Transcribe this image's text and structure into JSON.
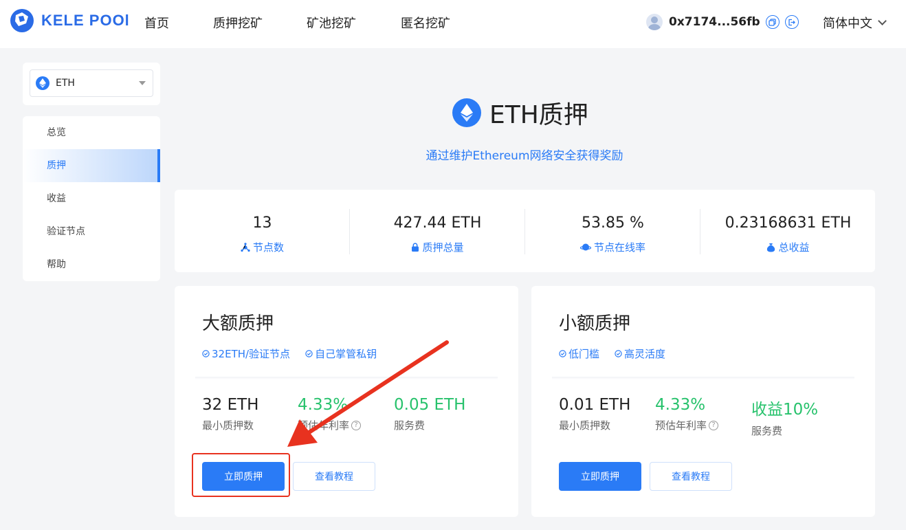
{
  "brand": {
    "logo_text": "KELE POOl"
  },
  "nav": {
    "items": [
      {
        "label": "首页"
      },
      {
        "label": "质押挖矿"
      },
      {
        "label": "矿池挖矿"
      },
      {
        "label": "匿名挖矿"
      }
    ]
  },
  "wallet": {
    "address": "0x7174...56fb"
  },
  "language": {
    "label": "简体中文"
  },
  "sidebar": {
    "coin_select": {
      "value": "ETH"
    },
    "menu": [
      {
        "label": "总览"
      },
      {
        "label": "质押",
        "active": true
      },
      {
        "label": "收益"
      },
      {
        "label": "验证节点"
      },
      {
        "label": "帮助"
      }
    ]
  },
  "hero": {
    "title": "ETH质押",
    "subtitle": "通过维护Ethereum网络安全获得奖励"
  },
  "stats": [
    {
      "value": "13",
      "label": "节点数",
      "icon": "nodes-icon"
    },
    {
      "value": "427.44 ETH",
      "label": "质押总量",
      "icon": "lock-icon"
    },
    {
      "value": "53.85 %",
      "label": "节点在线率",
      "icon": "planet-icon"
    },
    {
      "value": "0.23168631 ETH",
      "label": "总收益",
      "icon": "money-bag-icon"
    }
  ],
  "cards": {
    "large": {
      "title": "大额质押",
      "tags": [
        "32ETH/验证节点",
        "自己掌管私钥"
      ],
      "metrics": [
        {
          "value": "32 ETH",
          "label": "最小质押数"
        },
        {
          "value": "4.33%",
          "label": "预估年利率"
        },
        {
          "value": "0.05 ETH",
          "label": "服务费"
        }
      ],
      "primary_button": "立即质押",
      "secondary_button": "查看教程"
    },
    "small": {
      "title": "小额质押",
      "tags": [
        "低门槛",
        "高灵活度"
      ],
      "metrics": [
        {
          "value": "0.01 ETH",
          "label": "最小质押数"
        },
        {
          "value": "4.33%",
          "label": "预估年利率"
        },
        {
          "value": "收益10%",
          "label": "服务费"
        }
      ],
      "primary_button": "立即质押",
      "secondary_button": "查看教程"
    }
  },
  "colors": {
    "accent": "#2a7bf6",
    "green": "#27c26c",
    "annotation_red": "#e8321f"
  }
}
